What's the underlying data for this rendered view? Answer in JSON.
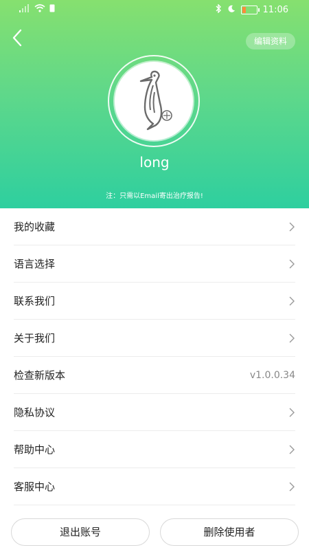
{
  "status_bar": {
    "time": "11:06"
  },
  "header": {
    "edit_label": "编辑资料",
    "username": "long",
    "note": "注：只需以Email寄出治疗报告!"
  },
  "menu": [
    {
      "label": "我的收藏",
      "value": ""
    },
    {
      "label": "语言选择",
      "value": ""
    },
    {
      "label": "联系我们",
      "value": ""
    },
    {
      "label": "关于我们",
      "value": ""
    },
    {
      "label": "检查新版本",
      "value": "v1.0.0.34"
    },
    {
      "label": "隐私协议",
      "value": ""
    },
    {
      "label": "帮助中心",
      "value": ""
    },
    {
      "label": "客服中心",
      "value": ""
    }
  ],
  "actions": {
    "logout_label": "退出账号",
    "delete_label": "删除使用者"
  }
}
